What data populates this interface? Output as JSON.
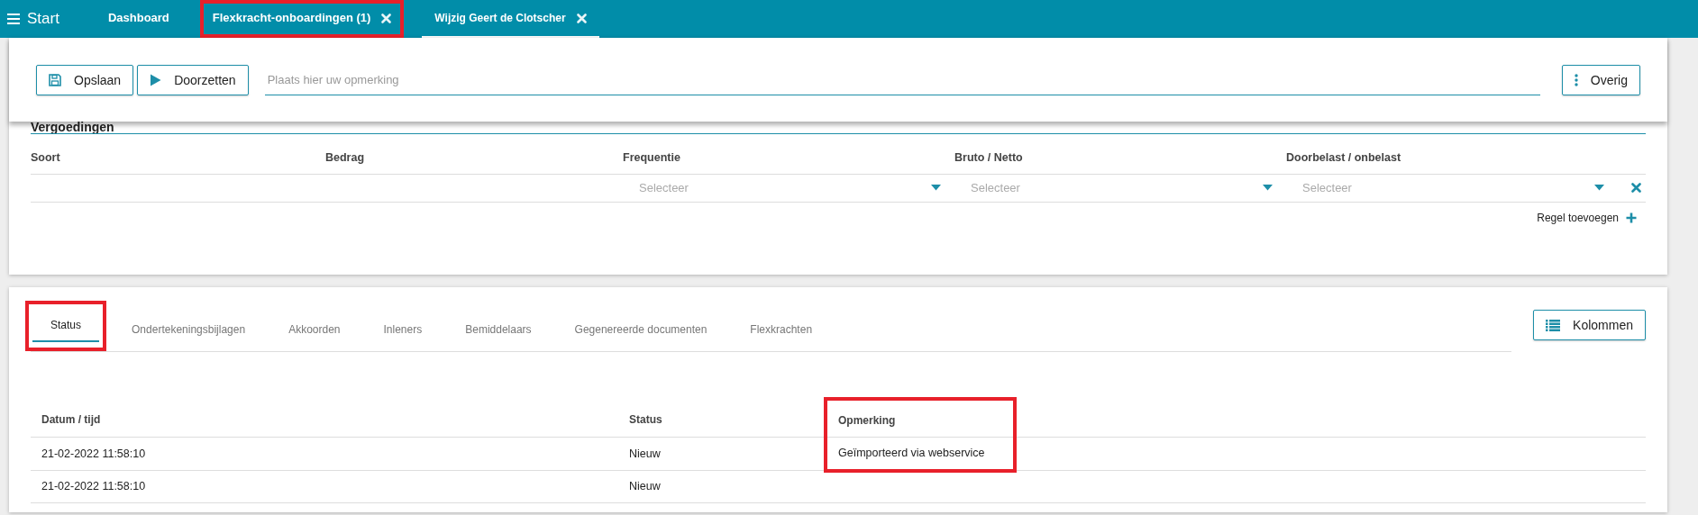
{
  "app": {
    "title": "Start"
  },
  "top_tabs": [
    {
      "label": "Dashboard",
      "selected": false,
      "closable": false,
      "highlighted": false
    },
    {
      "label": "Flexkracht-onboardingen (1)",
      "selected": false,
      "closable": true,
      "highlighted": true
    },
    {
      "label": "Wijzig Geert de Clotscher",
      "selected": true,
      "closable": true,
      "highlighted": false
    }
  ],
  "toolbar": {
    "buttons": [
      {
        "label": "Opslaan"
      },
      {
        "label": "Doorzetten"
      }
    ],
    "remark": {
      "placeholder": "Plaats hier uw opmerking"
    },
    "more_button": {
      "label": "Overig"
    }
  },
  "allowances": {
    "title": "Vergoedingen",
    "columns": [
      "Soort",
      "Bedrag",
      "Frequentie",
      "Bruto / Netto",
      "Doorbelast / onbelast"
    ],
    "rows": [
      {
        "selects": [
          {
            "placeholder": "Selecteer"
          },
          {
            "placeholder": "Selecteer"
          },
          {
            "placeholder": "Selecteer"
          }
        ]
      }
    ],
    "add_row": "Regel toevoegen"
  },
  "sub_tabs": [
    {
      "label": "Status",
      "selected": true,
      "highlighted": true
    },
    {
      "label": "Ondertekeningsbijlagen",
      "selected": false,
      "highlighted": false
    },
    {
      "label": "Akkoorden",
      "selected": false,
      "highlighted": false
    },
    {
      "label": "Inleners",
      "selected": false,
      "highlighted": false
    },
    {
      "label": "Bemiddelaars",
      "selected": false,
      "highlighted": false
    },
    {
      "label": "Gegenereerde documenten",
      "selected": false,
      "highlighted": false
    },
    {
      "label": "Flexkrachten",
      "selected": false,
      "highlighted": false
    }
  ],
  "columns_button": {
    "label": "Kolommen"
  },
  "status_table": {
    "columns": [
      {
        "label": "Datum / tijd",
        "highlighted": false
      },
      {
        "label": "Status",
        "highlighted": false
      },
      {
        "label": "Opmerking",
        "highlighted": true
      }
    ],
    "rows": [
      {
        "cells": [
          "21-02-2022 11:58:10",
          "Nieuw",
          "Geïmporteerd via webservice"
        ],
        "highlighted": true
      },
      {
        "cells": [
          "21-02-2022 11:58:10",
          "Nieuw"
        ],
        "highlighted": false
      }
    ]
  }
}
